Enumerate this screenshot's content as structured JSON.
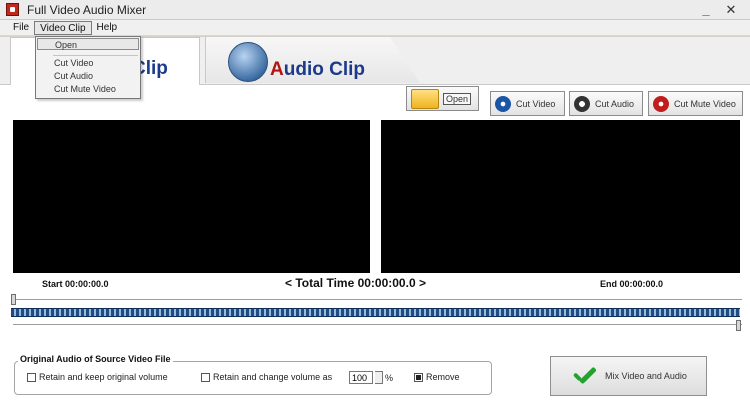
{
  "window": {
    "title": "Full Video Audio Mixer",
    "minimize_glyph": "_",
    "close_glyph": "✕"
  },
  "menu": {
    "items": [
      "File",
      "Video Clip",
      "Help"
    ],
    "video_clip_dropdown": [
      "Open",
      "Cut Video",
      "Cut Audio",
      "Cut Mute Video"
    ]
  },
  "tabs": [
    {
      "label": "Clip",
      "active": true
    },
    {
      "label_first": "A",
      "label_rest": "udio Clip",
      "active": false
    }
  ],
  "toolbar": {
    "open_label": "Open",
    "cut_video_label": "Cut Video",
    "cut_audio_label": "Cut Audio",
    "cut_mute_video_label": "Cut Mute Video"
  },
  "timeline": {
    "start_label": "Start 00:00:00.0",
    "total_label": "< Total Time 00:00:00.0 >",
    "end_label": "End 00:00:00.0"
  },
  "audio_options": {
    "legend": "Original Audio of Source Video File",
    "retain_keep_label": "Retain and keep original volume",
    "retain_change_label": "Retain and change volume as",
    "volume_value": "100",
    "percent_symbol": "%",
    "remove_label": "Remove",
    "retain_keep_checked": false,
    "retain_change_checked": false,
    "remove_checked": true
  },
  "mix_button_label": "Mix Video and Audio",
  "colors": {
    "screen": "#000000",
    "accent_blue": "#1b3a8c",
    "accent_red": "#b31414",
    "check_green": "#22a22e"
  }
}
